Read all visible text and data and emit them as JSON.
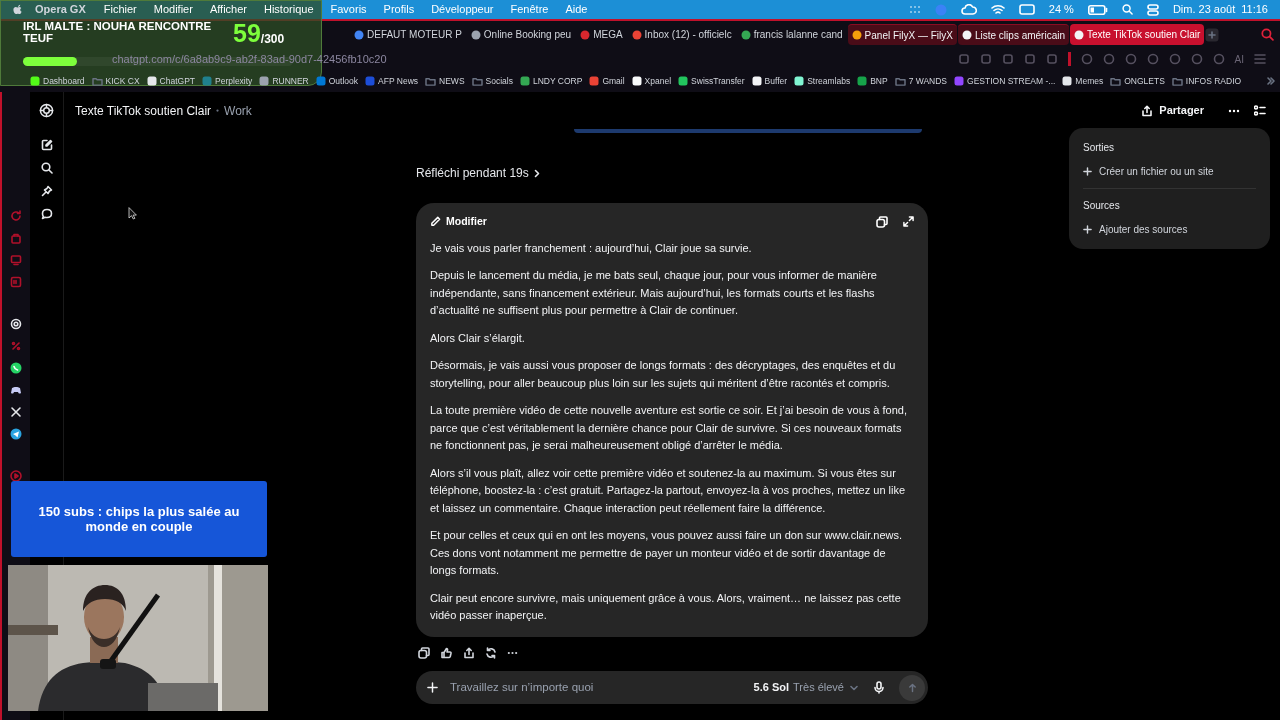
{
  "menu_bar": {
    "app": "Opera GX",
    "items": [
      "Fichier",
      "Modifier",
      "Afficher",
      "Historique",
      "Favoris",
      "Profils",
      "Développeur",
      "Fenêtre",
      "Aide"
    ],
    "battery": "24 %",
    "date": "Dim. 23 août",
    "time": "11:16"
  },
  "tabs": [
    {
      "title": "DEFAUT MOTEUR P",
      "selected": false,
      "grouped": false,
      "color": "#4285f4"
    },
    {
      "title": "Online Booking peu",
      "selected": false,
      "grouped": false,
      "color": "#9ca3af"
    },
    {
      "title": "MEGA",
      "selected": false,
      "grouped": false,
      "color": "#d9272e"
    },
    {
      "title": "Inbox (12) - officielc",
      "selected": false,
      "grouped": false,
      "color": "#ea4335"
    },
    {
      "title": "francis lalanne cand",
      "selected": false,
      "grouped": false,
      "color": "#34a853"
    },
    {
      "title": "Panel FilyX — FilyX",
      "selected": false,
      "grouped": true,
      "color": "#f59e0b"
    },
    {
      "title": "Liste clips américain",
      "selected": false,
      "grouped": true,
      "color": "#f3f4f6"
    },
    {
      "title": "Texte TikTok soutien Clair",
      "selected": true,
      "grouped": false,
      "color": "#f3f4f6"
    }
  ],
  "address": "chatgpt.com/c/6a8ab9c9-ab2f-83ad-90d7-42456fb10c20",
  "toolbar": {
    "ai_label": "AI"
  },
  "bookmarks": [
    {
      "label": "Dashboard",
      "kind": "site",
      "color": "#53fc18"
    },
    {
      "label": "KICK CX",
      "kind": "folder"
    },
    {
      "label": "ChatGPT",
      "kind": "site",
      "color": "#e5e7eb"
    },
    {
      "label": "Perplexity",
      "kind": "site",
      "color": "#20808d"
    },
    {
      "label": "RUNNER",
      "kind": "site",
      "color": "#9ca3af"
    },
    {
      "label": "Outlook",
      "kind": "site",
      "color": "#0078d4"
    },
    {
      "label": "AFP News",
      "kind": "site",
      "color": "#1d4ed8"
    },
    {
      "label": "NEWS",
      "kind": "folder"
    },
    {
      "label": "Socials",
      "kind": "folder"
    },
    {
      "label": "LNDY CORP",
      "kind": "site",
      "color": "#34a853"
    },
    {
      "label": "Gmail",
      "kind": "site",
      "color": "#ea4335"
    },
    {
      "label": "Xpanel",
      "kind": "site",
      "color": "#f9fafb"
    },
    {
      "label": "SwissTransfer",
      "kind": "site",
      "color": "#22c55e"
    },
    {
      "label": "Buffer",
      "kind": "site",
      "color": "#f3f4f6"
    },
    {
      "label": "Streamlabs",
      "kind": "site",
      "color": "#80f5d2"
    },
    {
      "label": "BNP",
      "kind": "site",
      "color": "#16a34a"
    },
    {
      "label": "7 WANDS",
      "kind": "folder"
    },
    {
      "label": "GESTION STREAM -...",
      "kind": "site",
      "color": "#9146ff"
    },
    {
      "label": "Memes",
      "kind": "site",
      "color": "#e5e7eb"
    },
    {
      "label": "ONGLETS",
      "kind": "folder"
    },
    {
      "label": "INFOS RADIO",
      "kind": "folder"
    }
  ],
  "chat": {
    "title": "Texte TikTok soutien Clair",
    "project": "Work",
    "share": "Partager",
    "thought": "Réfléchi pendant 19s",
    "canvas": {
      "edit": "Modifier",
      "paragraphs": [
        "Je vais vous parler franchement : aujourd’hui, Clair joue sa survie.",
        "Depuis le lancement du média, je me bats seul, chaque jour, pour vous informer de manière indépendante, sans financement extérieur. Mais aujourd’hui, les formats courts et les flashs d’actualité ne suffisent plus pour permettre à Clair de continuer.",
        "Alors Clair s’élargit.",
        "Désormais, je vais aussi vous proposer de longs formats : des décryptages, des enquêtes et du storytelling, pour aller beaucoup plus loin sur les sujets qui méritent d’être racontés et compris.",
        "La toute première vidéo de cette nouvelle aventure est sortie ce soir. Et j’ai besoin de vous à fond, parce que c’est véritablement la dernière chance pour Clair de survivre. Si ces nouveaux formats ne fonctionnent pas, je serai malheureusement obligé d’arrêter le média.",
        "Alors s’il vous plaît, allez voir cette première vidéo et soutenez-la au maximum. Si vous êtes sur téléphone, boostez-la : c’est gratuit. Partagez-la partout, envoyez-la à vos proches, mettez un like et laissez un commentaire. Chaque interaction peut réellement faire la différence.",
        "Et pour celles et ceux qui en ont les moyens, vous pouvez aussi faire un don sur www.clair.news. Ces dons vont notamment me permettre de payer un monteur vidéo et de sortir davantage de longs formats.",
        "Clair peut encore survivre, mais uniquement grâce à vous. Alors, vraiment… ne laissez pas cette vidéo passer inaperçue."
      ]
    },
    "composer": {
      "placeholder": "Travaillez sur n’importe quoi",
      "model": "5.6 Sol",
      "effort": "Très élevé"
    }
  },
  "side_panel": {
    "sections": [
      {
        "heading": "Sorties",
        "action": "Créer un fichier ou un site"
      },
      {
        "heading": "Sources",
        "action": "Ajouter des sources"
      }
    ]
  },
  "stream_overlay": {
    "title": "IRL MALTE : NOUHA RENCONTRE TEUF",
    "count": "59",
    "goal": "/300",
    "level": 0.2
  },
  "banner": "150 subs : chips la plus salée au monde en couple"
}
